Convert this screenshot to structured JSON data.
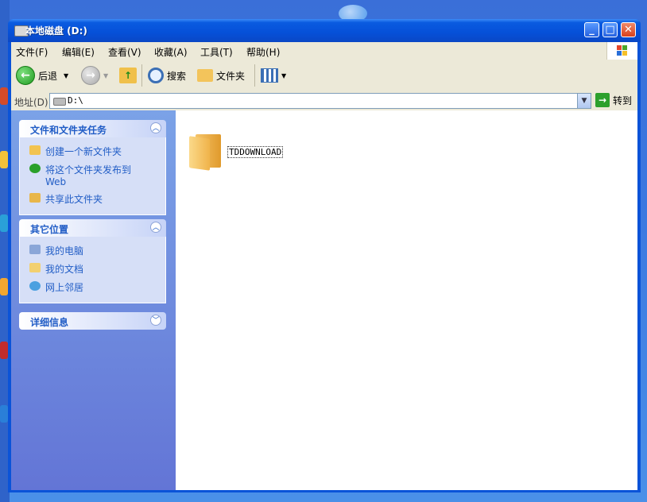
{
  "window": {
    "title": "本地磁盘 (D:)"
  },
  "menubar": {
    "items": [
      "文件(F)",
      "编辑(E)",
      "查看(V)",
      "收藏(A)",
      "工具(T)",
      "帮助(H)"
    ]
  },
  "toolbar": {
    "back_label": "后退",
    "search_label": "搜索",
    "folders_label": "文件夹"
  },
  "address": {
    "label": "地址(D)",
    "value": "D:\\",
    "go_label": "转到"
  },
  "taskpane": {
    "tasks": {
      "title": "文件和文件夹任务",
      "links": [
        "创建一个新文件夹",
        "将这个文件夹发布到 Web",
        "共享此文件夹"
      ]
    },
    "other_places": {
      "title": "其它位置",
      "links": [
        "我的电脑",
        "我的文档",
        "网上邻居"
      ]
    },
    "details": {
      "title": "详细信息"
    }
  },
  "content": {
    "items": [
      {
        "name": "TDDOWNLOAD",
        "icon": "folder-icon"
      }
    ]
  },
  "colors": {
    "title_blue": "#0a53d8",
    "link_blue": "#215dc6",
    "taskpane_top": "#7ba2e7",
    "taskpane_bottom": "#6375d6"
  }
}
